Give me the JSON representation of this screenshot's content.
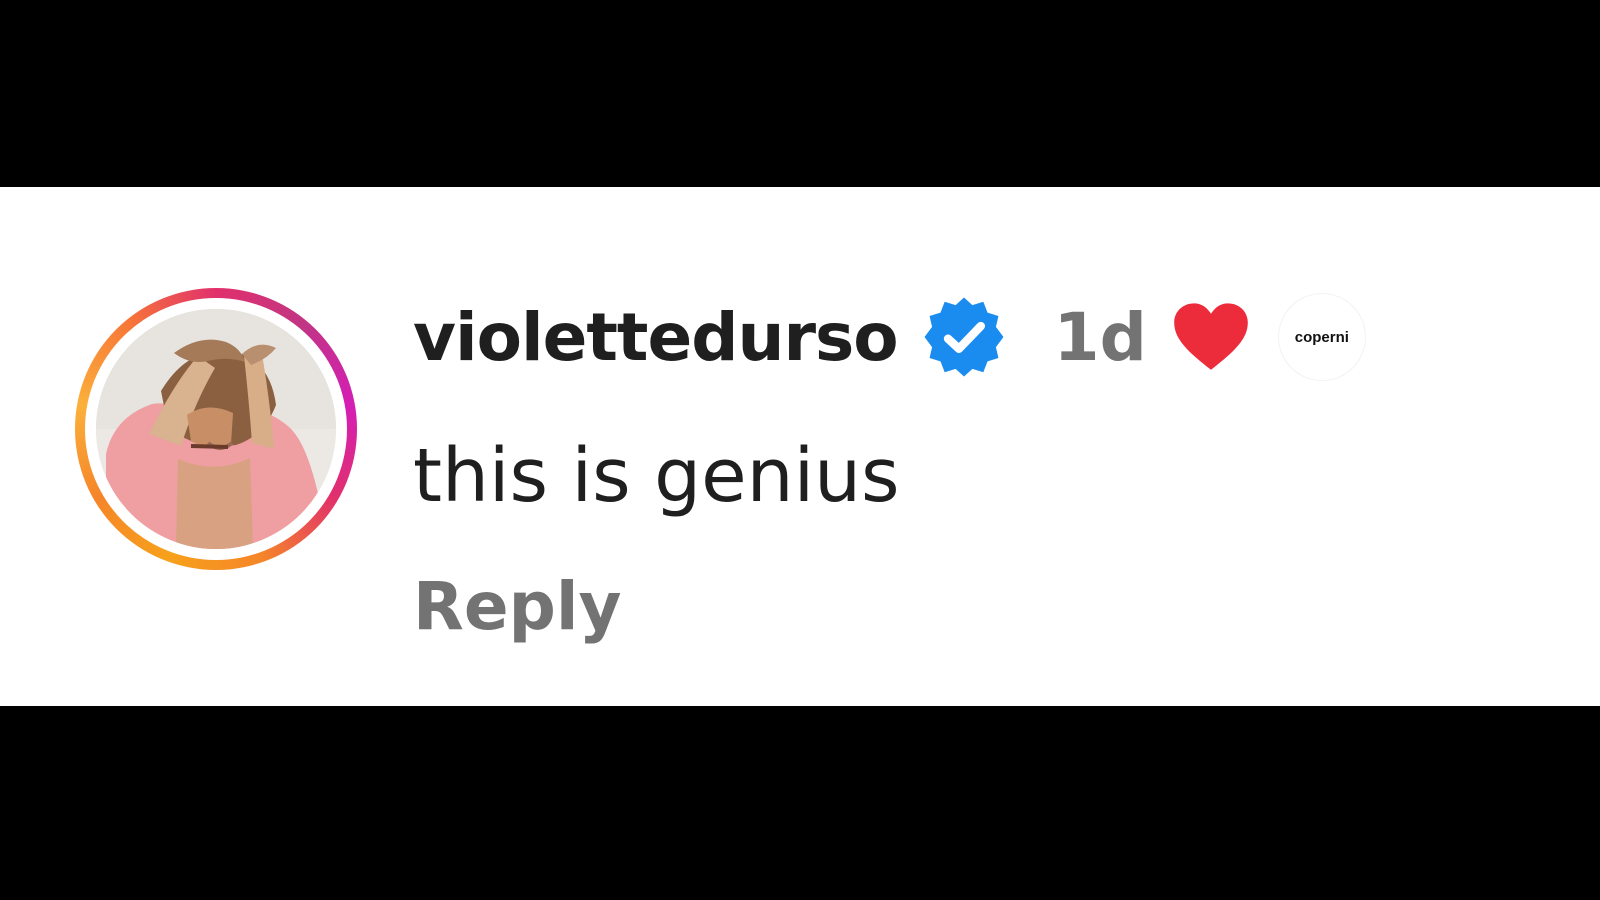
{
  "comment": {
    "username": "violettedurso",
    "verified_icon": "verified-badge-icon",
    "timestamp": "1d",
    "text": "this is genius",
    "reply_label": "Reply",
    "liked_icon": "heart-icon",
    "liked_by_avatar_text": "coperni",
    "avatar_icon": "profile-photo"
  },
  "colors": {
    "verified": "#1a8cf0",
    "heart": "#ed2c3b",
    "username": "#1f1f1f",
    "muted": "#737373",
    "story_ring_start": "#f7a11b",
    "story_ring_end": "#d41eb5"
  }
}
